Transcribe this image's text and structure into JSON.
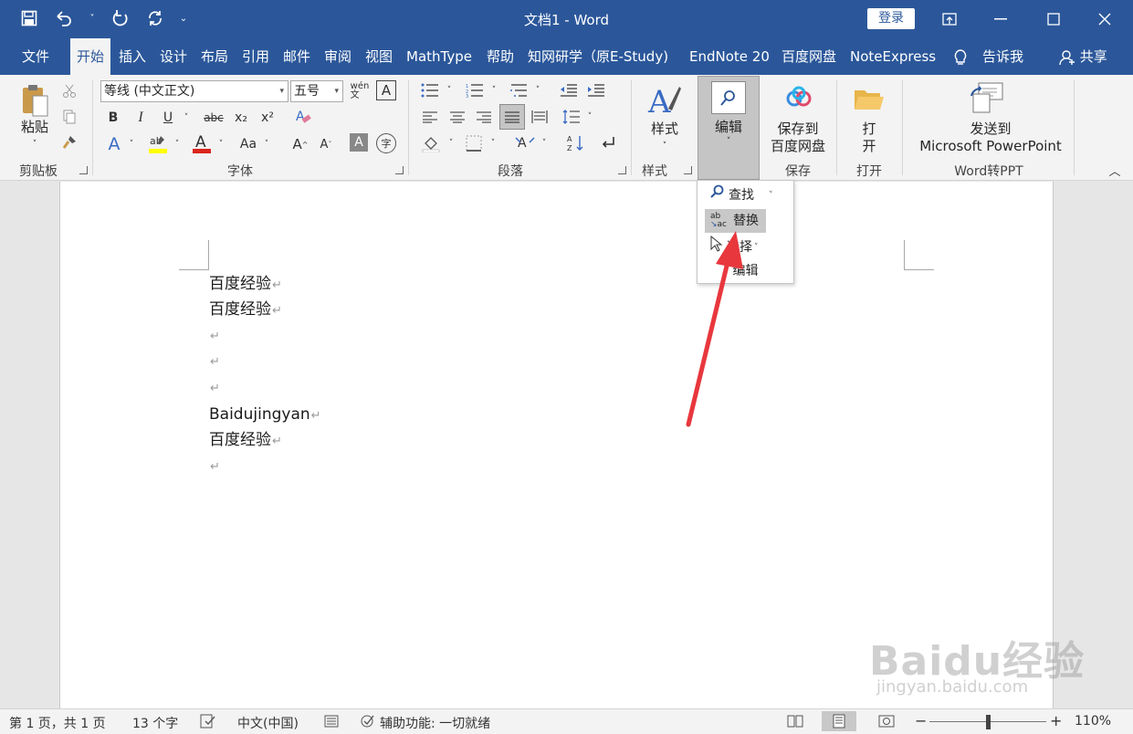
{
  "window": {
    "title": "文档1  -  Word",
    "login_label": "登录"
  },
  "qat": {
    "save_icon": "save-icon",
    "undo_icon": "undo-icon",
    "redo_icon": "redo-icon",
    "repeat_icon": "repeat-icon"
  },
  "tabs": [
    {
      "label": "文件"
    },
    {
      "label": "开始"
    },
    {
      "label": "插入"
    },
    {
      "label": "设计"
    },
    {
      "label": "布局"
    },
    {
      "label": "引用"
    },
    {
      "label": "邮件"
    },
    {
      "label": "审阅"
    },
    {
      "label": "视图"
    },
    {
      "label": "MathType"
    },
    {
      "label": "帮助"
    },
    {
      "label": "知网研学（原E-Study)"
    },
    {
      "label": "EndNote 20"
    },
    {
      "label": "百度网盘"
    },
    {
      "label": "NoteExpress"
    }
  ],
  "tell_me": "告诉我",
  "share": "共享",
  "ribbon": {
    "clipboard": {
      "paste": "粘贴",
      "label": "剪贴板"
    },
    "font": {
      "font_name": "等线 (中文正文)",
      "font_size": "五号",
      "label": "字体",
      "bold": "B",
      "italic": "I",
      "underline": "U",
      "strike": "abc",
      "sub": "x₂",
      "sup": "x²",
      "grow": "A",
      "shrink": "A",
      "case": "Aa"
    },
    "paragraph": {
      "label": "段落"
    },
    "styles": {
      "button": "样式",
      "label": "样式"
    },
    "editing": {
      "button": "编辑"
    },
    "save": {
      "line1": "保存到",
      "line2": "百度网盘",
      "label": "保存"
    },
    "open": {
      "line1": "打",
      "line2": "开",
      "label": "打开"
    },
    "ppt": {
      "line1": "发送到",
      "line2": "Microsoft PowerPoint",
      "label": "Word转PPT"
    }
  },
  "dropdown": {
    "find": "查找",
    "replace": "替换",
    "select": "选择",
    "editing": "编辑"
  },
  "document": {
    "lines": [
      "百度经验",
      "百度经验",
      "",
      "",
      "",
      "Baidujingyan",
      "百度经验",
      ""
    ],
    "para_mark": "↵"
  },
  "status": {
    "page": "第 1 页，共 1 页",
    "words": "13 个字",
    "language": "中文(中国)",
    "accessibility": "辅助功能: 一切就绪",
    "zoom": "110%",
    "zoom_minus": "−",
    "zoom_plus": "+"
  },
  "watermark": {
    "main": "Baidu经验",
    "sub": "jingyan.baidu.com"
  },
  "colors": {
    "brand": "#2b579a",
    "annotation_arrow": "#e8373d"
  }
}
